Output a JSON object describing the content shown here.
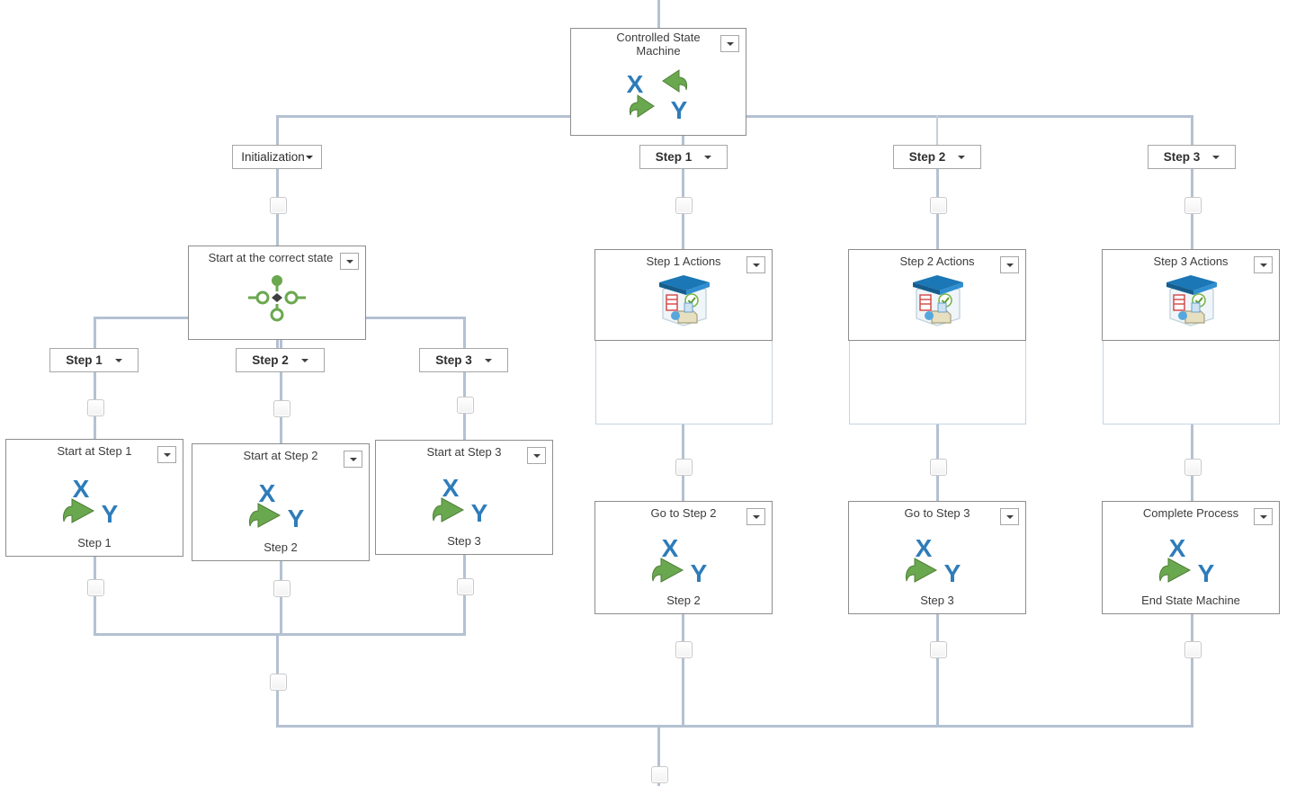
{
  "diagram": {
    "root": {
      "title_line1": "Controlled State",
      "title_line2": "Machine",
      "icon": "swap-xy-icon"
    },
    "branches": [
      {
        "label": "Initialization",
        "bold": false,
        "caret": "tight"
      },
      {
        "label": "Step 1",
        "bold": true,
        "caret": "spaced"
      },
      {
        "label": "Step 2",
        "bold": true,
        "caret": "spaced"
      },
      {
        "label": "Step 3",
        "bold": true,
        "caret": "spaced"
      }
    ],
    "initialization": {
      "switch_title": "Start at the correct state",
      "switch_icon": "switch-state-icon",
      "cases": [
        {
          "label": "Step 1"
        },
        {
          "label": "Step 2"
        },
        {
          "label": "Step 3"
        }
      ],
      "case_nodes": [
        {
          "title": "Start at Step 1",
          "footer": "Step 1",
          "icon": "goto-xy-icon"
        },
        {
          "title": "Start at Step 2",
          "footer": "Step 2",
          "icon": "goto-xy-icon"
        },
        {
          "title": "Start at Step 3",
          "footer": "Step 3",
          "icon": "goto-xy-icon"
        }
      ]
    },
    "steps": [
      {
        "actions_title": "Step 1 Actions",
        "actions_icon": "sequence-box-icon",
        "goto_title": "Go to Step 2",
        "goto_footer": "Step 2",
        "goto_icon": "goto-xy-icon"
      },
      {
        "actions_title": "Step 2 Actions",
        "actions_icon": "sequence-box-icon",
        "goto_title": "Go to Step 3",
        "goto_footer": "Step 3",
        "goto_icon": "goto-xy-icon"
      },
      {
        "actions_title": "Step 3 Actions",
        "actions_icon": "sequence-box-icon",
        "goto_title": "Complete Process",
        "goto_footer": "End State Machine",
        "goto_icon": "goto-xy-icon"
      }
    ],
    "colors": {
      "connector": "#b4c1d2",
      "connector_thin": "#c3cfdd",
      "node_border": "#8d8d8d",
      "body_border": "#c6d4e2",
      "icon_blue": "#2e7cba",
      "icon_green": "#6aa84f",
      "text": "#3c3c3c"
    }
  }
}
